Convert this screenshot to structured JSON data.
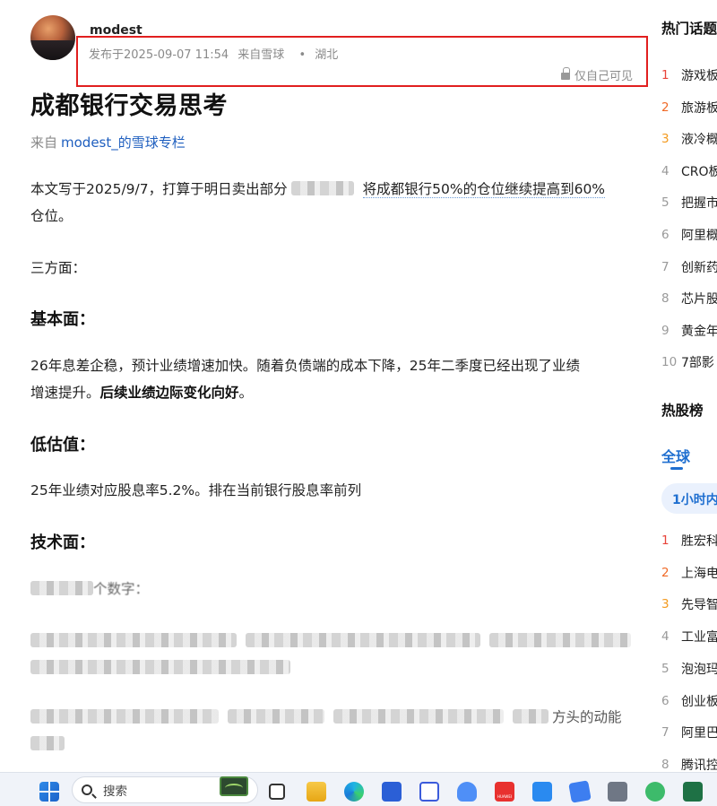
{
  "post": {
    "author": "modest_",
    "published": "发布于2025-09-07 11:54",
    "via": "来自雪球",
    "dot": "•",
    "location": "湖北",
    "visibility": "仅自己可见",
    "title": "成都银行交易思考",
    "source_prefix": "来自",
    "source_link": "modest_的雪球专栏"
  },
  "article": {
    "p1_a": "本文写于2025/9/7，打算于明日卖出部分",
    "p1_b": "将成都银行50%的仓位继续提高到60%",
    "p1_c": "仓位。",
    "p2": "三方面：",
    "h_fundamental": "基本面：",
    "p3_a": "26年息差企稳，预计业绩增速加快。随着负债端的成本下降，25年二季度已经出现了业绩",
    "p3_b": "增速提升。",
    "p3_bold": "后续业绩边际变化向好",
    "p3_end": "。",
    "h_valuation": "低估值：",
    "p4": "25年业绩对应股息率5.2%。排在当前银行股息率前列",
    "h_technical": "技术面：",
    "blur_tail_1": "个数字：",
    "blur_tail_2": "方头的动能"
  },
  "sidebar": {
    "hot_topics_title": "热门话题",
    "topics": [
      {
        "rank": "1",
        "label": "游戏板"
      },
      {
        "rank": "2",
        "label": "旅游板"
      },
      {
        "rank": "3",
        "label": "液冷概"
      },
      {
        "rank": "4",
        "label": "CRO板"
      },
      {
        "rank": "5",
        "label": "把握市"
      },
      {
        "rank": "6",
        "label": "阿里概"
      },
      {
        "rank": "7",
        "label": "创新药"
      },
      {
        "rank": "8",
        "label": "芯片股"
      },
      {
        "rank": "9",
        "label": "黄金年"
      },
      {
        "rank": "10",
        "label": "7部影"
      }
    ],
    "hot_stocks_title": "热股榜",
    "tab_global": "全球",
    "pill_label": "1小时内",
    "stocks": [
      {
        "rank": "1",
        "label": "胜宏科"
      },
      {
        "rank": "2",
        "label": "上海电"
      },
      {
        "rank": "3",
        "label": "先导智"
      },
      {
        "rank": "4",
        "label": "工业富"
      },
      {
        "rank": "5",
        "label": "泡泡玛"
      },
      {
        "rank": "6",
        "label": "创业板"
      },
      {
        "rank": "7",
        "label": "阿里巴"
      },
      {
        "rank": "8",
        "label": "腾讯控"
      }
    ]
  },
  "taskbar": {
    "search_placeholder": "搜索",
    "huawei_label": "HUAWEI"
  }
}
